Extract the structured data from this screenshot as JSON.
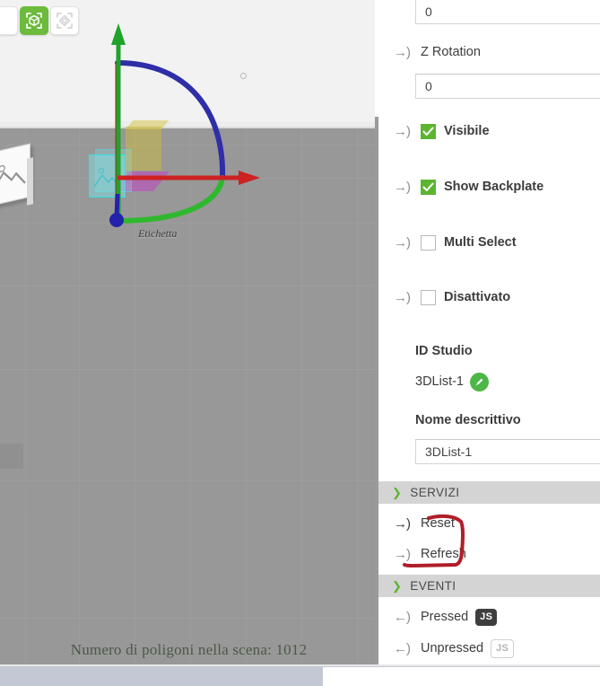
{
  "viewport": {
    "toolbar": [
      {
        "name": "partial-button",
        "icon": "blank-icon",
        "active": false
      },
      {
        "name": "object-mode-button",
        "icon": "cube-target-icon",
        "active": true
      },
      {
        "name": "face-mode-button",
        "icon": "diamond-target-icon",
        "active": false
      }
    ],
    "scene_label": "Etichetta",
    "polycount": "Numero di poligoni nella scena: 1012",
    "gizmo": {
      "x_axis_color": "#cc2222",
      "y_axis_color": "#1fa32a",
      "z_axis_color": "#2222aa",
      "arc_blue_color": "#2e2ea8",
      "arc_green_color": "#2eb82e",
      "origin_color": "#2222aa"
    },
    "objects": {
      "yellow_box_color": "#c8b946",
      "magenta_plane_color": "#c43cc4",
      "cyan_card_color": "#33e0e8",
      "picture_icon": "image-placeholder-icon"
    }
  },
  "panel": {
    "y_rotation_value": "0",
    "z_rotation": {
      "label": "Z Rotation",
      "value": "0"
    },
    "toggles": [
      {
        "label": "Visibile",
        "checked": true
      },
      {
        "label": "Show Backplate",
        "checked": true
      },
      {
        "label": "Multi Select",
        "checked": false
      },
      {
        "label": "Disattivato",
        "checked": false
      }
    ],
    "id_studio": {
      "label": "ID Studio",
      "value": "3DList-1",
      "edit_icon": "pencil-icon"
    },
    "nome_descrittivo": {
      "label": "Nome descrittivo",
      "value": "3DList-1"
    },
    "servizi": {
      "header": "SERVIZI",
      "items": [
        {
          "label": "Reset"
        },
        {
          "label": "Refresh"
        }
      ]
    },
    "eventi": {
      "header": "EVENTI",
      "items": [
        {
          "label": "Pressed",
          "badge": "JS",
          "badge_active": true
        },
        {
          "label": "Unpressed",
          "badge": "JS",
          "badge_active": false
        }
      ]
    }
  },
  "annotation": {
    "color": "#b01e28",
    "shape": "hand-drawn-bracket"
  }
}
